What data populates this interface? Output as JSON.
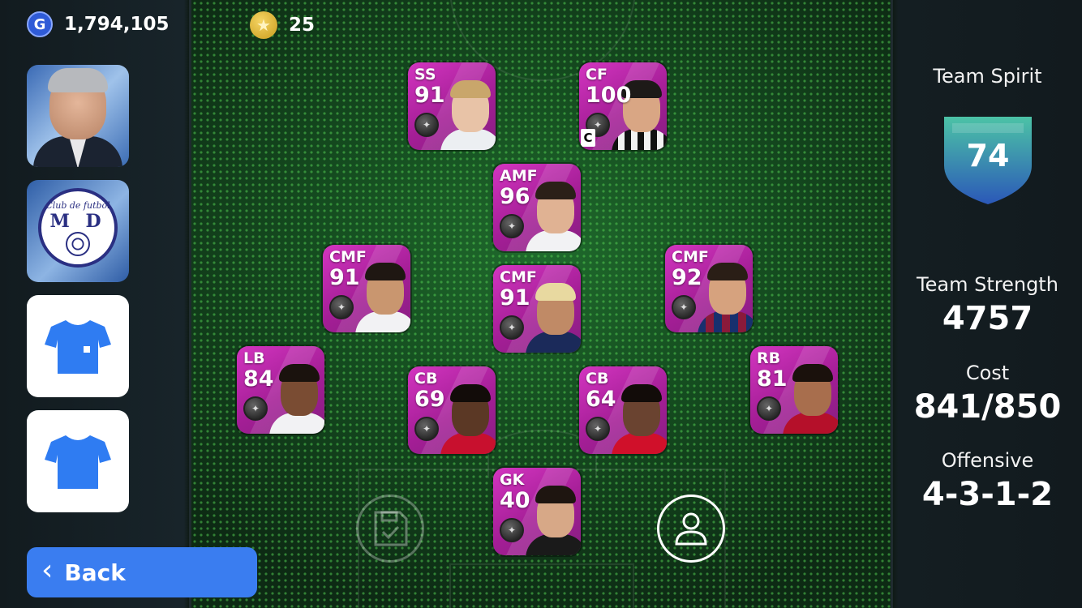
{
  "top_bar": {
    "gp_icon": "G",
    "gp_amount": "1,794,105",
    "star_amount": "25"
  },
  "left_panel": {
    "manager_icon": "manager-portrait",
    "emblem": {
      "top_text": "Club de futbol",
      "initials": "M D"
    },
    "home_kit_icon": "shirt-icon",
    "away_kit_icon": "shirt-icon",
    "back_label": "Back"
  },
  "players": [
    {
      "pos": "SS",
      "ovr": "91"
    },
    {
      "pos": "CF",
      "ovr": "100",
      "captain": "C"
    },
    {
      "pos": "AMF",
      "ovr": "96"
    },
    {
      "pos": "CMF",
      "ovr": "91"
    },
    {
      "pos": "CMF",
      "ovr": "91"
    },
    {
      "pos": "CMF",
      "ovr": "92"
    },
    {
      "pos": "LB",
      "ovr": "84"
    },
    {
      "pos": "CB",
      "ovr": "69"
    },
    {
      "pos": "CB",
      "ovr": "64"
    },
    {
      "pos": "RB",
      "ovr": "81"
    },
    {
      "pos": "GK",
      "ovr": "40"
    }
  ],
  "right_panel": {
    "team_spirit_label": "Team Spirit",
    "team_spirit_value": "74",
    "team_strength_label": "Team Strength",
    "team_strength_value": "4757",
    "cost_label": "Cost",
    "cost_value": "841/850",
    "offensive_label": "Offensive",
    "offensive_value": "4-3-1-2"
  },
  "colors": {
    "card_purple": "#c02bb0",
    "back_blue": "#3a7df0",
    "kit_blue": "#2f7cf2",
    "shield_teal": "#3fb6a8"
  }
}
